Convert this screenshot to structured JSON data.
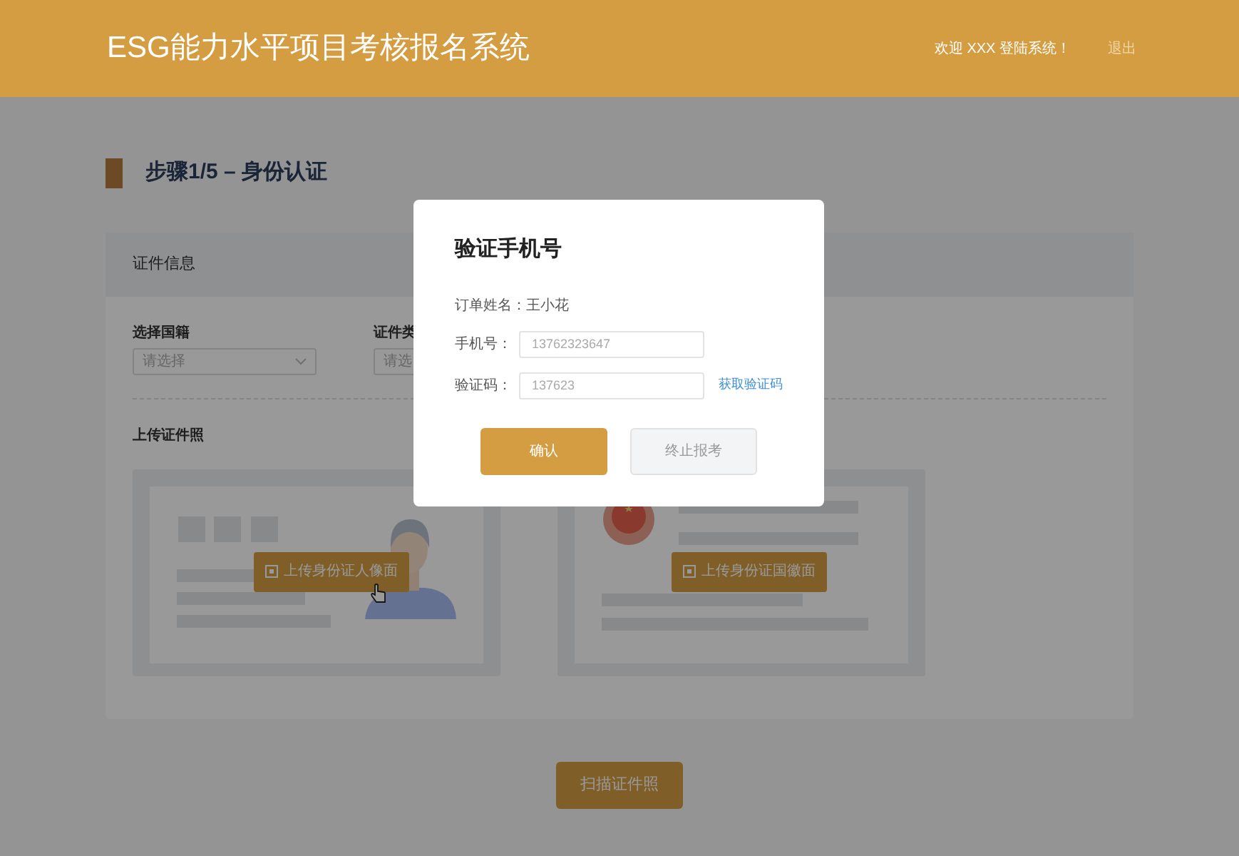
{
  "header": {
    "title": "ESG能力水平项目考核报名系统",
    "welcome": "欢迎 XXX 登陆系统！",
    "logout": "退出"
  },
  "step": {
    "title": "步骤1/5 – 身份认证"
  },
  "card": {
    "title": "证件信息",
    "fields": [
      {
        "label": "选择国籍",
        "placeholder": "请选择"
      },
      {
        "label": "证件类",
        "placeholder": "请选"
      }
    ],
    "upload_label": "上传证件照",
    "uploads": [
      {
        "kind": "portrait",
        "button": "上传身份证人像面"
      },
      {
        "kind": "emblem",
        "button": "上传身份证国徽面"
      }
    ]
  },
  "scan_button": "扫描证件照",
  "modal": {
    "title": "验证手机号",
    "name_line": "订单姓名：王小花",
    "fields": [
      {
        "label": "手机号：",
        "value": "13762323647"
      },
      {
        "label": "验证码：",
        "value": "137623",
        "link": "获取验证码"
      }
    ],
    "buttons": [
      {
        "label": "确认",
        "kind": "primary"
      },
      {
        "label": "终止报考",
        "kind": "secondary"
      }
    ]
  }
}
